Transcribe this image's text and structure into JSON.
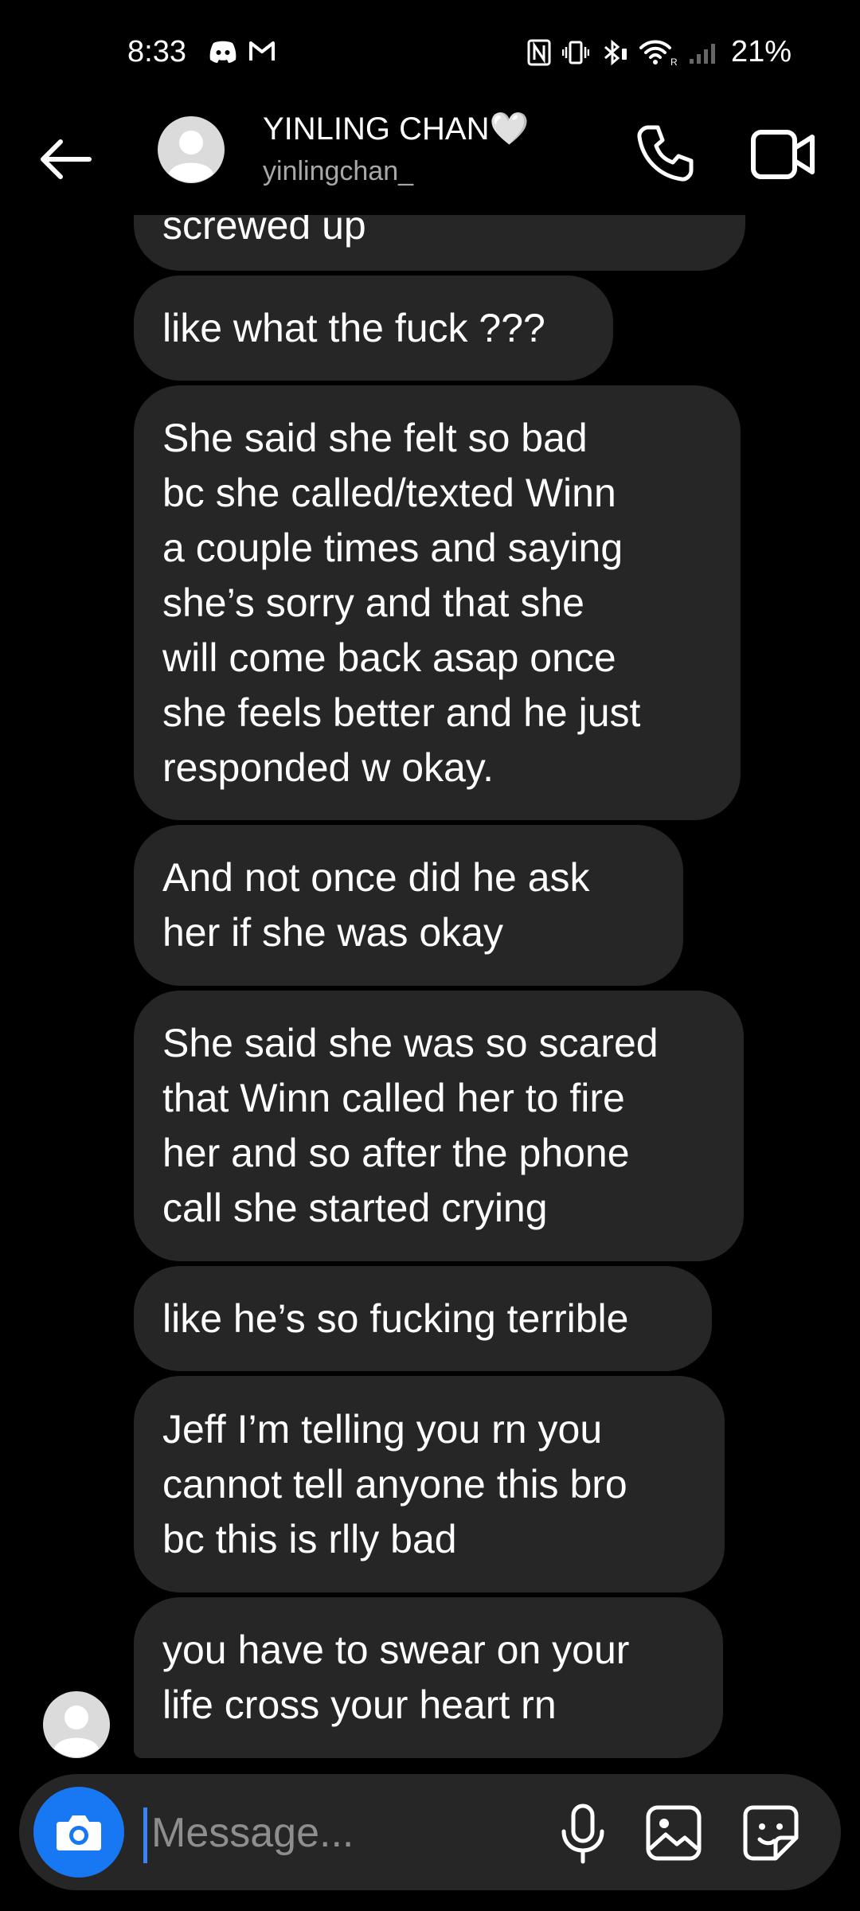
{
  "status_bar": {
    "time": "8:33",
    "battery": "21%",
    "icons": [
      "discord-icon",
      "gmail-icon",
      "nfc-icon",
      "vibrate-icon",
      "bluetooth-icon",
      "wifi-icon",
      "signal-icon"
    ]
  },
  "header": {
    "name": "YINLING CHAN🤍",
    "username": "yinlingchan_"
  },
  "messages": [
    "screwed up",
    "like what the fuck ???",
    "She said she felt so bad\nbc she called/texted Winn\na couple times and saying\nshe’s sorry and that she\nwill come back asap once\nshe feels better and he just\nresponded w okay.",
    "And not once did he ask\nher if she was okay",
    "She said she was so scared\nthat Winn called her to fire\nher and so after the phone\ncall she started crying",
    "like he’s so fucking terrible",
    "Jeff I’m telling you rn you\ncannot tell anyone this bro\nbc this is rlly bad",
    "you have to swear on your\nlife cross your heart rn"
  ],
  "composer": {
    "placeholder": "Message..."
  },
  "colors": {
    "background": "#000000",
    "bubble": "#262626",
    "accent": "#1877f2"
  }
}
